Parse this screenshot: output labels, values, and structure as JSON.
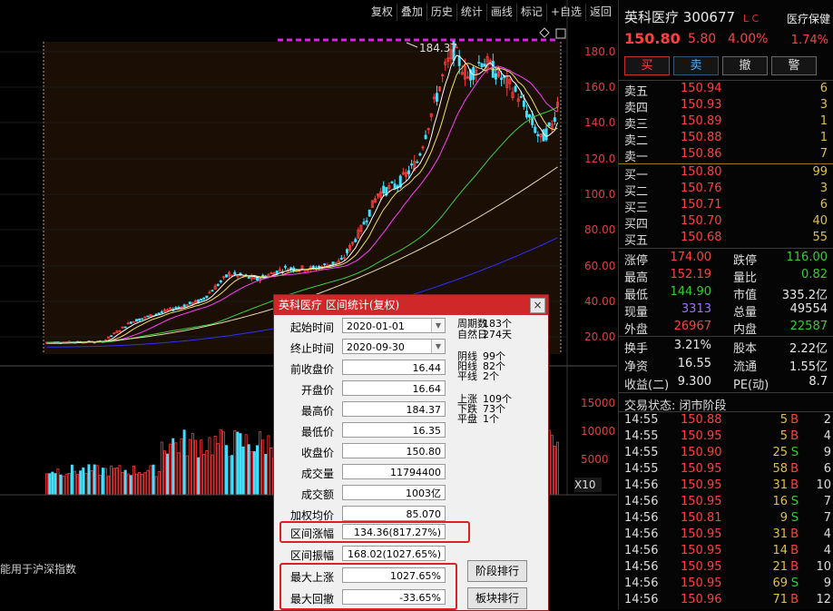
{
  "toolbar": {
    "items": [
      "复权",
      "叠加",
      "历史",
      "统计",
      "画线",
      "标记",
      "+自选",
      "返回"
    ]
  },
  "chart": {
    "price_axis": [
      "180.0",
      "160.0",
      "140.0",
      "120.0",
      "100.0",
      "80.00",
      "60.00",
      "40.00",
      "20.00"
    ],
    "volume_axis": [
      "15000",
      "10000",
      "5000"
    ],
    "peak_label": "184.37",
    "volume_multiplier": "X10",
    "bottom_note": "能用于沪深指数"
  },
  "stock": {
    "name": "英科医疗",
    "code": "300677",
    "flag": "L C",
    "sector": "医疗保健",
    "price": "150.80",
    "change": "5.80",
    "change_pct": "4.00%",
    "turnover_badge": "1.74%"
  },
  "trade_buttons": [
    "买",
    "卖",
    "撤",
    "警"
  ],
  "order_book": {
    "asks": [
      {
        "label": "卖五",
        "price": "150.94",
        "vol": "6"
      },
      {
        "label": "卖四",
        "price": "150.93",
        "vol": "3"
      },
      {
        "label": "卖三",
        "price": "150.89",
        "vol": "1"
      },
      {
        "label": "卖二",
        "price": "150.88",
        "vol": "1"
      },
      {
        "label": "卖一",
        "price": "150.86",
        "vol": "7"
      }
    ],
    "bids": [
      {
        "label": "买一",
        "price": "150.80",
        "vol": "99"
      },
      {
        "label": "买二",
        "price": "150.76",
        "vol": "3"
      },
      {
        "label": "买三",
        "price": "150.71",
        "vol": "6"
      },
      {
        "label": "买四",
        "price": "150.70",
        "vol": "40"
      },
      {
        "label": "买五",
        "price": "150.68",
        "vol": "55"
      }
    ]
  },
  "quote": {
    "rows1": [
      {
        "l1": "涨停",
        "v1": "174.00",
        "c1": "red",
        "l2": "跌停",
        "v2": "116.00",
        "c2": "green"
      },
      {
        "l1": "最高",
        "v1": "152.19",
        "c1": "red",
        "l2": "量比",
        "v2": "0.82",
        "c2": "green"
      },
      {
        "l1": "最低",
        "v1": "144.90",
        "c1": "green",
        "l2": "市值",
        "v2": "335.2亿",
        "c2": "white"
      },
      {
        "l1": "现量",
        "v1": "3313",
        "c1": "purple",
        "l2": "总量",
        "v2": "49554",
        "c2": "white"
      },
      {
        "l1": "外盘",
        "v1": "26967",
        "c1": "red",
        "l2": "内盘",
        "v2": "22587",
        "c2": "green"
      }
    ],
    "rows2": [
      {
        "l1": "换手",
        "v1": "3.21%",
        "c1": "white",
        "l2": "股本",
        "v2": "2.22亿",
        "c2": "white"
      },
      {
        "l1": "净资",
        "v1": "16.55",
        "c1": "white",
        "l2": "流通",
        "v2": "1.55亿",
        "c2": "white"
      },
      {
        "l1": "收益(二)",
        "v1": "9.300",
        "c1": "white",
        "l2": "PE(动)",
        "v2": "8.7",
        "c2": "white"
      }
    ]
  },
  "trade_state": "交易状态: 闭市阶段",
  "ticks": [
    {
      "t": "14:55",
      "p": "150.88",
      "v": "5",
      "s": "B",
      "n": "2"
    },
    {
      "t": "14:55",
      "p": "150.95",
      "v": "5",
      "s": "B",
      "n": "4"
    },
    {
      "t": "14:55",
      "p": "150.90",
      "v": "25",
      "s": "S",
      "n": "9"
    },
    {
      "t": "14:55",
      "p": "150.95",
      "v": "58",
      "s": "B",
      "n": "6"
    },
    {
      "t": "14:56",
      "p": "150.95",
      "v": "31",
      "s": "B",
      "n": "10"
    },
    {
      "t": "14:56",
      "p": "150.95",
      "v": "16",
      "s": "S",
      "n": "7"
    },
    {
      "t": "14:56",
      "p": "150.81",
      "v": "9",
      "s": "S",
      "n": "7"
    },
    {
      "t": "14:56",
      "p": "150.95",
      "v": "31",
      "s": "B",
      "n": "4"
    },
    {
      "t": "14:56",
      "p": "150.95",
      "v": "14",
      "s": "B",
      "n": "4"
    },
    {
      "t": "14:56",
      "p": "150.95",
      "v": "21",
      "s": "B",
      "n": "10"
    },
    {
      "t": "14:56",
      "p": "150.95",
      "v": "69",
      "s": "S",
      "n": "9"
    },
    {
      "t": "14:56",
      "p": "150.96",
      "v": "71",
      "s": "B",
      "n": "12"
    }
  ],
  "dialog": {
    "title": "英科医疗 区间统计(复权)",
    "close": "×",
    "fields": [
      {
        "label": "起始时间",
        "value": "2020-01-01",
        "kind": "date"
      },
      {
        "label": "终止时间",
        "value": "2020-09-30",
        "kind": "date"
      },
      {
        "label": "前收盘价",
        "value": "16.44"
      },
      {
        "label": "开盘价",
        "value": "16.64"
      },
      {
        "label": "最高价",
        "value": "184.37"
      },
      {
        "label": "最低价",
        "value": "16.35"
      },
      {
        "label": "收盘价",
        "value": "150.80"
      },
      {
        "label": "成交量",
        "value": "11794400"
      },
      {
        "label": "成交额",
        "value": "1003亿"
      },
      {
        "label": "加权均价",
        "value": "85.070"
      },
      {
        "label": "区间涨幅",
        "value": "134.36(817.27%)"
      },
      {
        "label": "区间振幅",
        "value": "168.02(1027.65%)"
      },
      {
        "label": "最大上涨",
        "value": "1027.65%"
      },
      {
        "label": "最大回撤",
        "value": "-33.65%"
      }
    ],
    "stats": [
      {
        "label": "周期数",
        "value": "183个"
      },
      {
        "label": "自然日",
        "value": "274天"
      },
      {
        "label": "阴线",
        "value": "99个"
      },
      {
        "label": "阳线",
        "value": "82个"
      },
      {
        "label": "平线",
        "value": "2个"
      },
      {
        "label": "上涨",
        "value": "109个"
      },
      {
        "label": "下跌",
        "value": "73个"
      },
      {
        "label": "平盘",
        "value": "1个"
      }
    ],
    "buttons": [
      "阶段排行",
      "板块排行"
    ]
  }
}
